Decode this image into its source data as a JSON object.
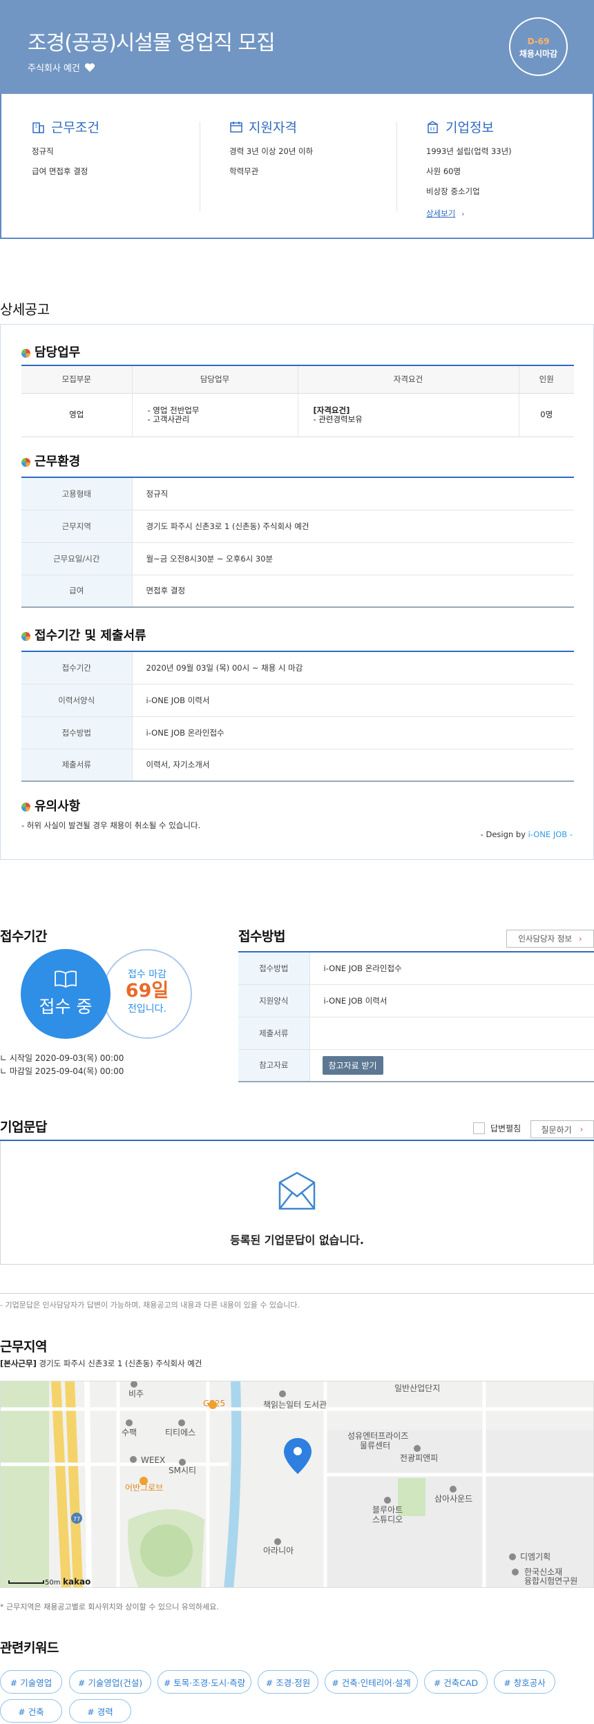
{
  "header": {
    "title": "조경(공공)시설물 영업직 모집",
    "company": "주식회사 예건",
    "dday": "D-69",
    "deadline_type": "채용시마감"
  },
  "summary": {
    "work": {
      "title": "근무조건",
      "items": [
        "정규직",
        "급여 면접후 결정"
      ]
    },
    "qual": {
      "title": "지원자격",
      "items": [
        "경력 3년 이상 20년 이하",
        "학력무관"
      ]
    },
    "company": {
      "title": "기업정보",
      "items": [
        "1993년 설립(업력 33년)",
        "사원 60명",
        "비상장 중소기업"
      ],
      "link": "상세보기"
    }
  },
  "detail": {
    "title": "상세공고",
    "duty": {
      "title": "담당업무",
      "headers": [
        "모집부문",
        "담당업무",
        "자격요건",
        "인원"
      ],
      "row": {
        "part": "영업",
        "duty1": "- 영업 전반업무",
        "duty2": "- 고객사관리",
        "qual_title": "[자격요건]",
        "qual1": "- 관련경력보유",
        "count": "0명"
      }
    },
    "env": {
      "title": "근무환경",
      "rows": [
        {
          "k": "고용형태",
          "v": "정규직"
        },
        {
          "k": "근무지역",
          "v": "경기도 파주시 신촌3로 1 (신촌동) 주식회사 예건"
        },
        {
          "k": "근무요일/시간",
          "v": "월~금 오전8시30분 ~ 오후6시 30분"
        },
        {
          "k": "급여",
          "v": "면접후 결정"
        }
      ]
    },
    "apply": {
      "title": "접수기간 및 제출서류",
      "rows": [
        {
          "k": "접수기간",
          "v": "2020년 09월 03일 (목) 00시 ~ 채용 시 마감"
        },
        {
          "k": "이력서양식",
          "v": "i-ONE JOB 이력서"
        },
        {
          "k": "접수방법",
          "v": "i-ONE JOB 온라인접수"
        },
        {
          "k": "제출서류",
          "v": "이력서, 자기소개서"
        }
      ]
    },
    "caution": {
      "title": "유의사항",
      "text": "- 허위 사실이 발견될 경우 채용이 취소될 수 있습니다."
    },
    "design_prefix": "- Design by ",
    "design_brand": "i-ONE JOB",
    "design_suffix": " -"
  },
  "period": {
    "title": "접수기간",
    "status": "접수 중",
    "close_label": "접수 마감",
    "days": "69일",
    "days_suffix": "전입니다.",
    "start": "시작일 2020-09-03(목) 00:00",
    "end": "마감일 2025-09-04(목) 00:00"
  },
  "method": {
    "title": "접수방법",
    "hr_button": "인사담당자 정보",
    "rows": [
      {
        "k": "접수방법",
        "v": "i-ONE JOB 온라인접수"
      },
      {
        "k": "지원양식",
        "v": "i-ONE JOB 이력서"
      },
      {
        "k": "제출서류",
        "v": ""
      },
      {
        "k": "참고자료",
        "v": ""
      }
    ],
    "ref_button": "참고자료 받기"
  },
  "qna": {
    "title": "기업문답",
    "answered_label": "답변펼침",
    "ask_button": "질문하기",
    "empty": "등록된 기업문답이 없습니다.",
    "note": "- 기업문답은 인사담당자가 답변이 가능하며, 채용공고의 내용과 다른 내용이 있을 수 있습니다."
  },
  "location": {
    "title": "근무지역",
    "branch": "[본사근무]",
    "address": "경기도 파주시 신촌3로 1 (신촌동) 주식회사 예건",
    "note": "* 근무지역은 채용공고별로 회사위치와 상이할 수 있으니 유의하세요.",
    "map": {
      "labels": [
        "비주",
        "GS25",
        "책읽는일터 도서관",
        "수팩",
        "티티에스",
        "WEEX",
        "SM시티",
        "어반그로브",
        "성유엔터프라이즈",
        "물류센터",
        "전광피앤피",
        "블루아트",
        "스튜디오",
        "삼아사운드",
        "아라니아",
        "디엠기획",
        "한국신소재",
        "융합시험연구원",
        "일반산업단지",
        "77"
      ],
      "scale": "50m",
      "brand": "kakao"
    }
  },
  "keywords": {
    "title": "관련키워드",
    "items": [
      "# 기술영업",
      "# 기술영업(건설)",
      "# 토목·조경·도시·측량",
      "# 조경·정원",
      "# 건축·인테리어·설계",
      "# 건축CAD",
      "# 창호공사",
      "# 건축",
      "# 경력"
    ]
  },
  "colors": {
    "hero": "#7296c3",
    "accent": "#2f6bbf",
    "dday": "#ffb36b",
    "days": "#e86a2a"
  }
}
